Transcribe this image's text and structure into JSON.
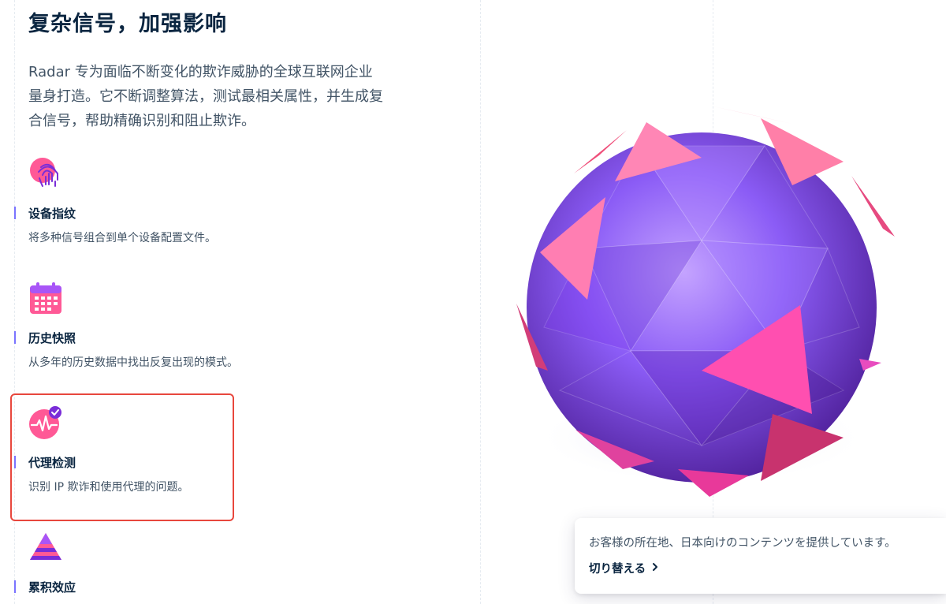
{
  "section": {
    "title": "复杂信号，加强影响",
    "intro": "Radar 专为面临不断变化的欺诈威胁的全球互联网企业量身打造。它不断调整算法，测试最相关属性，并生成复合信号，帮助精确识别和阻止欺诈。"
  },
  "features": [
    {
      "title": "设备指纹",
      "desc": "将多种信号组合到单个设备配置文件。",
      "icon": "fingerprint-icon"
    },
    {
      "title": "历史快照",
      "desc": "从多年的历史数据中找出反复出现的模式。",
      "icon": "calendar-icon"
    },
    {
      "title": "代理检测",
      "desc": "识别 IP 欺诈和使用代理的问题。",
      "icon": "heartbeat-check-icon"
    },
    {
      "title": "累积效应",
      "desc": "",
      "icon": "layered-pyramid-icon"
    }
  ],
  "toast": {
    "message": "お客様の所在地、日本向けのコンテンツを提供しています。",
    "link_label": "切り替える",
    "link_icon": "chevron-right-icon"
  },
  "colors": {
    "heading": "#0a2540",
    "body_text": "#425466",
    "accent_purple": "#7a73ff",
    "accent_pink": "#ff5996",
    "highlight_red": "#e8473d",
    "sphere_purple": "#8b5cf6"
  }
}
